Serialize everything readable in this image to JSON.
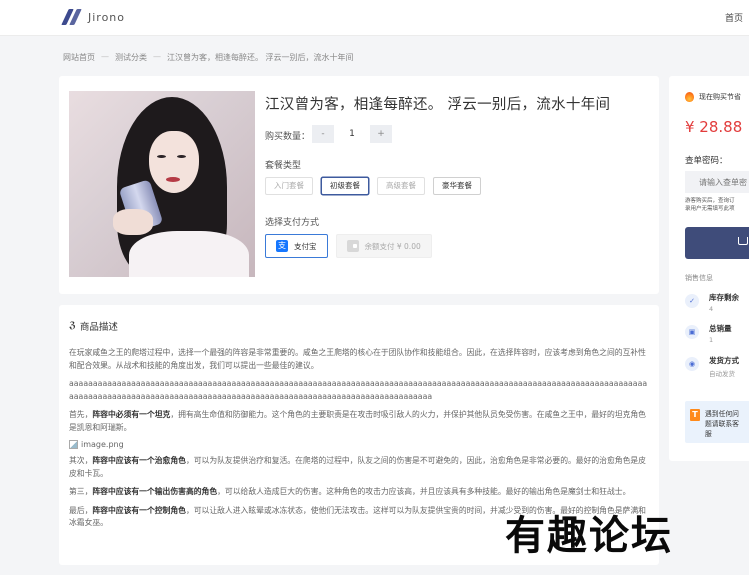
{
  "header": {
    "logo_text": "Jirono",
    "nav_home": "首页"
  },
  "breadcrumb": [
    "网站首页",
    "测试分类",
    "江汉曾为客，相逢每醉还。 浮云一别后，流水十年间"
  ],
  "product": {
    "title": "江汉曾为客，相逢每醉还。 浮云一别后，流水十年间",
    "qty_label": "购买数量：",
    "qty_minus": "-",
    "qty_value": "1",
    "qty_plus": "+",
    "package_label": "套餐类型",
    "packages": [
      {
        "label": "入门套餐",
        "state": "disabled"
      },
      {
        "label": "初级套餐",
        "state": "selected"
      },
      {
        "label": "高级套餐",
        "state": "disabled"
      },
      {
        "label": "豪华套餐",
        "state": "normal"
      }
    ],
    "payment_label": "选择支付方式",
    "payments": [
      {
        "label": "支付宝",
        "icon": "alipay-icon",
        "icon_glyph": "支"
      },
      {
        "label": "余额支付 ¥ 0.00",
        "icon": "wallet-icon"
      }
    ]
  },
  "description": {
    "heading": "商品描述",
    "heading_icon": "h5-icon",
    "paragraphs": [
      {
        "pre": "在玩家咸鱼之王的爬塔过程中，选择一个最强的阵容是非常重要的。咸鱼之王爬塔的核心在于团队协作和技能组合。因此，在选择阵容时，应该考虑到角色之间的互补性和配合效果。从战术和技能的角度出发，我们可以提出一些最佳的建议。",
        "bold": "",
        "post": ""
      },
      {
        "pre": "aaaaaaaaaaaaaaaaaaaaaaaaaaaaaaaaaaaaaaaaaaaaaaaaaaaaaaaaaaaaaaaaaaaaaaaaaaaaaaaaaaaaaaaaaaaaaaaaaaaaaaaaaaaaaaaaaaaaaaaaaaaaaaaaaaaaaaaaaaaaaaaaaaaaaaaaaaaaaaaaaaaaaaaaaaaaaaaaaaaaaaaaaaaaaaaaaaaaa",
        "bold": "",
        "post": ""
      },
      {
        "pre": "首先，",
        "bold": "阵容中必须有一个坦克",
        "post": "，拥有高生命值和防御能力。这个角色的主要职责是在攻击时吸引敌人的火力，并保护其他队员免受伤害。在咸鱼之王中，最好的坦克角色是凯恩和阿瑞斯。"
      }
    ],
    "image_alt": "image.png",
    "paragraphs_after": [
      {
        "pre": "其次，",
        "bold": "阵容中应该有一个治愈角色",
        "post": "，可以为队友提供治疗和复活。在爬塔的过程中，队友之间的伤害是不可避免的，因此，治愈角色是非常必要的。最好的治愈角色是皮皮和卡瓦。"
      },
      {
        "pre": "第三，",
        "bold": "阵容中应该有一个输出伤害高的角色",
        "post": "，可以给敌人造成巨大的伤害。这种角色的攻击力应该高，并且应该具有多种技能。最好的输出角色是魔剑士和狂战士。"
      },
      {
        "pre": "最后，",
        "bold": "阵容中应该有一个控制角色",
        "post": "，可以让敌人进入眩晕或冰冻状态，使他们无法攻击。这样可以为队友提供宝贵的时间，并减少受到的伤害。最好的控制角色是萨满和冰霜女巫。"
      }
    ]
  },
  "sidebar": {
    "promo_text": "现在购买节省",
    "price": "¥ 28.88",
    "query_label": "查单密码：",
    "query_placeholder": "请输入查单密",
    "hint_line1": "游客购买后，查询订",
    "hint_line2": "录用户无需填写此项",
    "sales_label": "销售信息",
    "items": [
      {
        "title": "库存剩余",
        "value": "4",
        "icon": "check-circle-icon",
        "glyph": "✓"
      },
      {
        "title": "总销量",
        "value": "1",
        "icon": "truck-icon",
        "glyph": "▣"
      },
      {
        "title": "发货方式",
        "value": "自动发货",
        "icon": "location-pin-icon",
        "glyph": "◉"
      }
    ],
    "banner_text": "遇到任何问题请联系客服",
    "banner_icon_glyph": "T"
  },
  "watermark": "有趣论坛"
}
